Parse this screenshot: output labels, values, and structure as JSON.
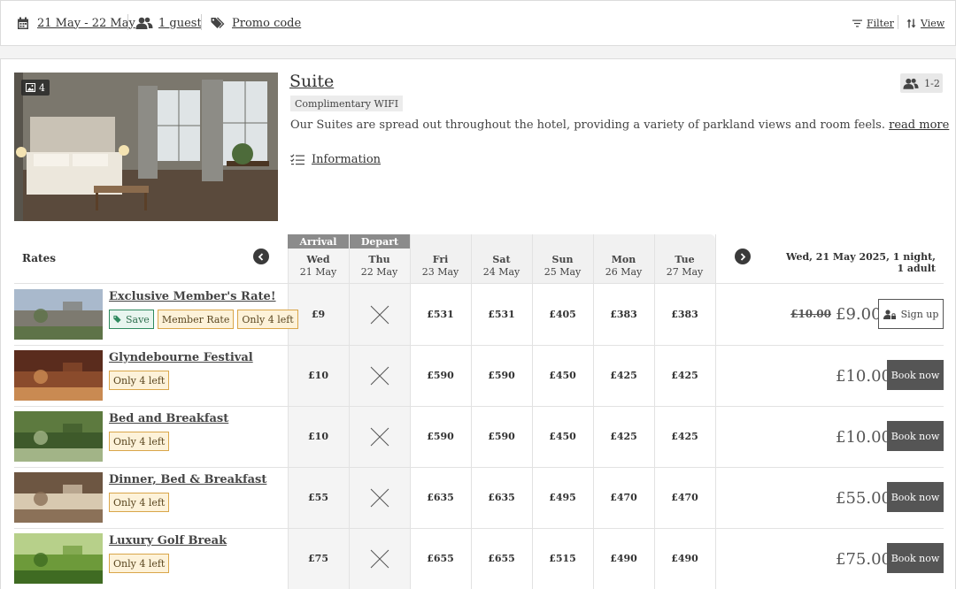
{
  "search": {
    "dates_label": "21 May - 22 May",
    "guests_label": "1 guest",
    "promo_label": "Promo code",
    "filter_label": "Filter",
    "view_label": "View"
  },
  "room": {
    "photo_count": "4",
    "title": "Suite",
    "amenity_tag": "Complimentary WIFI",
    "description": "Our Suites are spread out throughout the hotel, providing a variety of parkland views and room feels.",
    "read_more": "read more",
    "information_label": "Information",
    "occupancy": "1-2"
  },
  "grid": {
    "rates_label": "Rates",
    "arrival_label": "Arrival",
    "depart_label": "Depart",
    "summary_line1": "Wed, 21 May 2025, 1 night,",
    "summary_line2": "1 adult",
    "days": [
      {
        "day": "Wed",
        "date": "21 May"
      },
      {
        "day": "Thu",
        "date": "22 May"
      },
      {
        "day": "Fri",
        "date": "23 May"
      },
      {
        "day": "Sat",
        "date": "24 May"
      },
      {
        "day": "Sun",
        "date": "25 May"
      },
      {
        "day": "Mon",
        "date": "26 May"
      },
      {
        "day": "Tue",
        "date": "27 May"
      }
    ]
  },
  "rates": [
    {
      "name": "Exclusive Member's Rate!",
      "tag_save": "Save",
      "tag_member": "Member Rate",
      "tag_left": "Only 4 left",
      "prices": [
        "£9",
        "",
        "£531",
        "£531",
        "£405",
        "£383",
        "£383"
      ],
      "old_price": "£10.00",
      "price": "£9.00",
      "action": "Sign up"
    },
    {
      "name": "Glyndebourne Festival",
      "tag_left": "Only 4 left",
      "prices": [
        "£10",
        "",
        "£590",
        "£590",
        "£450",
        "£425",
        "£425"
      ],
      "price": "£10.00",
      "action": "Book now"
    },
    {
      "name": "Bed and Breakfast",
      "tag_left": "Only 4 left",
      "prices": [
        "£10",
        "",
        "£590",
        "£590",
        "£450",
        "£425",
        "£425"
      ],
      "price": "£10.00",
      "action": "Book now"
    },
    {
      "name": "Dinner, Bed & Breakfast",
      "tag_left": "Only 4 left",
      "prices": [
        "£55",
        "",
        "£635",
        "£635",
        "£495",
        "£470",
        "£470"
      ],
      "price": "£55.00",
      "action": "Book now"
    },
    {
      "name": "Luxury Golf Break",
      "tag_left": "Only 4 left",
      "prices": [
        "£75",
        "",
        "£655",
        "£655",
        "£515",
        "£490",
        "£490"
      ],
      "price": "£75.00",
      "action": "Book now"
    }
  ]
}
